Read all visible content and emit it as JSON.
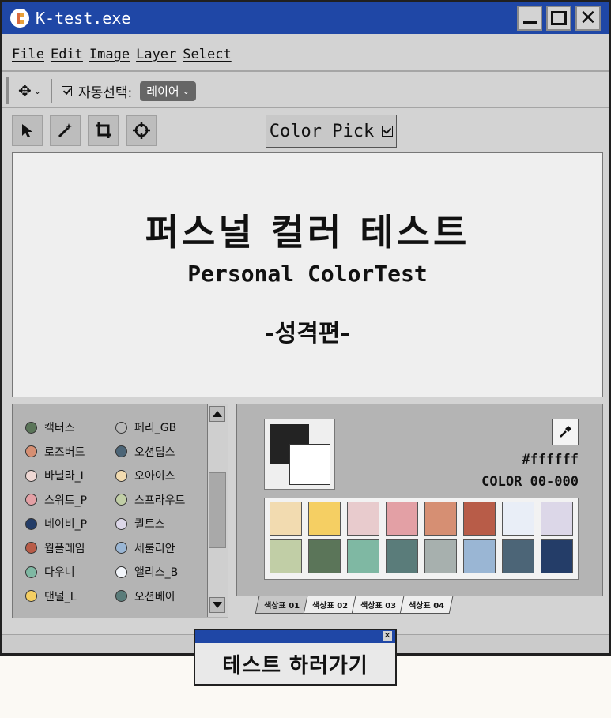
{
  "window": {
    "title": "K-test.exe"
  },
  "menu": [
    "File",
    "Edit",
    "Image",
    "Layer",
    "Select"
  ],
  "toolbar": {
    "auto_select_label": "자동선택:",
    "layer_value": "레이어"
  },
  "colorpick": {
    "label": "Color Pick"
  },
  "canvas": {
    "title": "퍼스널 컬러 테스트",
    "subtitle": "Personal ColorTest",
    "edition": "-성격편-"
  },
  "color_list": {
    "left": [
      {
        "label": "캑터스",
        "color": "#5b7559"
      },
      {
        "label": "로즈버드",
        "color": "#d68f73"
      },
      {
        "label": "바닐라_I",
        "color": "#efd8d4"
      },
      {
        "label": "스위트_P",
        "color": "#e3a0a5"
      },
      {
        "label": "네이비_P",
        "color": "#243d68"
      },
      {
        "label": "웜플레임",
        "color": "#b85c48"
      },
      {
        "label": "다우니",
        "color": "#7fb8a3"
      },
      {
        "label": "댄덜_L",
        "color": "#f5cf63"
      }
    ],
    "right": [
      {
        "label": "페리_GB",
        "color": "#b7b7b7"
      },
      {
        "label": "오션딥스",
        "color": "#4c6577"
      },
      {
        "label": "오아이스",
        "color": "#f2dbb0"
      },
      {
        "label": "스프라우트",
        "color": "#c1cea6"
      },
      {
        "label": "퀼트스",
        "color": "#dcd7e8"
      },
      {
        "label": "세룰리안",
        "color": "#9ab6d4"
      },
      {
        "label": "앨리스_B",
        "color": "#f2f5fa"
      },
      {
        "label": "오션베이",
        "color": "#5a7c7a"
      }
    ]
  },
  "picker": {
    "foreground": "#232323",
    "background": "#ffffff",
    "hex": "#ffffff",
    "code": "COLOR 00-000",
    "swatches": [
      "#f2dbb0",
      "#f5cf63",
      "#e8cbcd",
      "#e3a0a5",
      "#d68f73",
      "#b85c48",
      "#e9eef7",
      "#dcd7e8",
      "#c1cea6",
      "#5b7559",
      "#7fb8a3",
      "#5a7c7a",
      "#a7b0ae",
      "#9ab6d4",
      "#4c6577",
      "#243d68"
    ],
    "tabs": [
      "색상표 01",
      "색상표 02",
      "색상표 03",
      "색상표 04"
    ]
  },
  "popup": {
    "label": "테스트 하러가기"
  }
}
